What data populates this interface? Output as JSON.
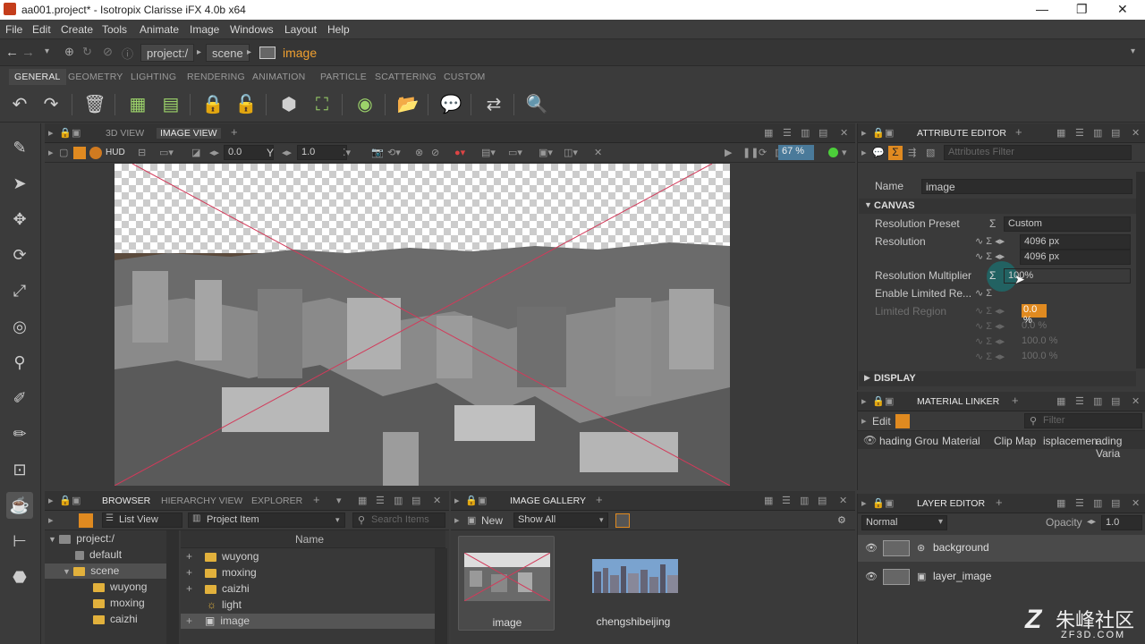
{
  "title": "aa001.project* - Isotropix Clarisse iFX 4.0b x64",
  "window_buttons": [
    "—",
    "❐",
    "✕"
  ],
  "menu": [
    "File",
    "Edit",
    "Create",
    "Tools",
    "Animate",
    "Image",
    "Windows",
    "Layout",
    "Help"
  ],
  "breadcrumb": [
    "project:/",
    "scene",
    "image"
  ],
  "module_tabs": [
    "GENERAL",
    "GEOMETRY",
    "LIGHTING",
    "RENDERING",
    "ANIMATION",
    "PARTICLE",
    "SCATTERING",
    "CUSTOM"
  ],
  "view_tabs": [
    "3D VIEW",
    "IMAGE VIEW"
  ],
  "view_toolbar": {
    "hud": "HUD",
    "exposure": "0.0",
    "gamma_label": "Y",
    "gamma": "1.0",
    "zoom": "67 %"
  },
  "attribute_editor": {
    "tab": "ATTRIBUTE EDITOR",
    "filter_placeholder": "Attributes Filter",
    "name_label": "Name",
    "name_value": "image",
    "section_canvas": "CANVAS",
    "resolution_preset_label": "Resolution Preset",
    "resolution_preset_value": "Custom",
    "resolution_label": "Resolution",
    "resolution_w": "4096 px",
    "resolution_h": "4096 px",
    "multiplier_label": "Resolution Multiplier",
    "multiplier_value": "100%",
    "enable_limited_label": "Enable Limited Re...",
    "limited_region_label": "Limited Region",
    "limited_region_values": [
      "0.0 %",
      "0.0 %",
      "100.0 %",
      "100.0 %"
    ],
    "section_display": "DISPLAY"
  },
  "material_linker": {
    "tab": "MATERIAL LINKER",
    "edit": "Edit",
    "filter_placeholder": "Filter",
    "columns": [
      "hading Grou",
      "Material",
      "Clip Map",
      "isplacemen",
      "ading Varia"
    ]
  },
  "layer_editor": {
    "tab": "LAYER EDITOR",
    "blend_mode": "Normal",
    "opacity_label": "Opacity",
    "opacity_value": "1.0",
    "layers": [
      "background",
      "layer_image"
    ]
  },
  "browser": {
    "tabs": [
      "BROWSER",
      "HIERARCHY VIEW",
      "EXPLORER"
    ],
    "list_view": "List View",
    "project_item": "Project Item",
    "search_placeholder": "Search Items",
    "tree": [
      "project:/",
      "default",
      "scene",
      "wuyong",
      "moxing",
      "caizhi"
    ],
    "column_name": "Name",
    "items": [
      "wuyong",
      "moxing",
      "caizhi",
      "light",
      "image"
    ]
  },
  "image_gallery": {
    "tab": "IMAGE GALLERY",
    "new_label": "New",
    "show_all": "Show All",
    "items": [
      "image",
      "chengshibeijing"
    ]
  },
  "watermark": {
    "big": "朱峰社区",
    "small": "ZF3D.COM"
  }
}
